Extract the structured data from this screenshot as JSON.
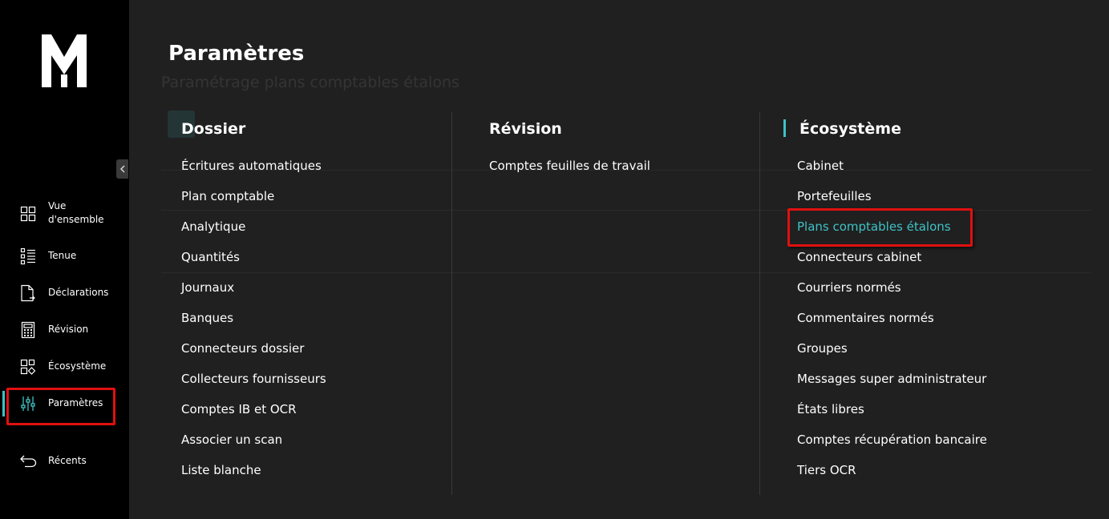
{
  "sidebar": {
    "items": [
      {
        "label": "Vue\nd'ensemble",
        "icon": "grid-icon"
      },
      {
        "label": "Tenue",
        "icon": "list-icon"
      },
      {
        "label": "Déclarations",
        "icon": "document-icon"
      },
      {
        "label": "Révision",
        "icon": "calculator-icon"
      },
      {
        "label": "Écosystème",
        "icon": "ecosystem-icon"
      },
      {
        "label": "Paramètres",
        "icon": "sliders-icon",
        "active": true
      },
      {
        "label": "Récents",
        "icon": "undo-arrow-icon"
      }
    ]
  },
  "page": {
    "title": "Paramètres",
    "background_subtitle": "Paramétrage plans comptables étalons"
  },
  "menu": {
    "dossier": {
      "title": "Dossier",
      "items": [
        "Écritures automatiques",
        "Plan comptable",
        "Analytique",
        "Quantités",
        "Journaux",
        "Banques",
        "Connecteurs dossier",
        "Collecteurs fournisseurs",
        "Comptes IB et OCR",
        "Associer un scan",
        "Liste blanche"
      ]
    },
    "revision": {
      "title": "Révision",
      "items": [
        "Comptes feuilles de travail"
      ]
    },
    "ecosysteme": {
      "title": "Écosystème",
      "items": [
        "Cabinet",
        "Portefeuilles",
        "Plans comptables étalons",
        "Connecteurs cabinet",
        "Courriers normés",
        "Commentaires normés",
        "Groupes",
        "Messages super administrateur",
        "États libres",
        "Comptes récupération bancaire",
        "Tiers OCR"
      ],
      "selected_index": 2
    }
  },
  "colors": {
    "accent": "#3fc2c6",
    "highlight_outline": "#e01010",
    "sidebar_bg": "#000000",
    "panel_bg": "#202020"
  }
}
